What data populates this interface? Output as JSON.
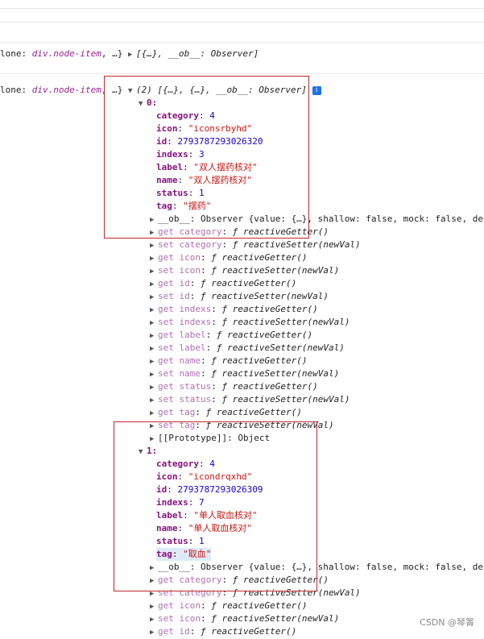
{
  "line1": {
    "prefix": "lone: ",
    "ref": "div.node-item",
    "rest": ", …} ",
    "summary": "[{…}, __ob__: Observer]"
  },
  "line2": {
    "prefix": "lone: ",
    "ref": "div.node-item",
    "rest": ", …} ",
    "summary": "(2) [{…}, {…}, __ob__: Observer]",
    "info": "i"
  },
  "item0": {
    "index": "0:",
    "props": [
      {
        "key": "category",
        "value": "4",
        "type": "num"
      },
      {
        "key": "icon",
        "value": "\"iconsrbyhd\"",
        "type": "str"
      },
      {
        "key": "id",
        "value": "2793787293026320",
        "type": "num"
      },
      {
        "key": "indexs",
        "value": "3",
        "type": "num"
      },
      {
        "key": "label",
        "value": "\"双人摆药核对\"",
        "type": "str"
      },
      {
        "key": "name",
        "value": "\"双人摆药核对\"",
        "type": "str"
      },
      {
        "key": "status",
        "value": "1",
        "type": "num"
      },
      {
        "key": "tag",
        "value": "\"摆药\"",
        "type": "str"
      }
    ],
    "ob_line": "__ob__: Observer {value: {…}, shallow: false, mock: false, dep",
    "accessors": [
      [
        "get",
        "category",
        "reactiveGetter()"
      ],
      [
        "set",
        "category",
        "reactiveSetter(newVal)"
      ],
      [
        "get",
        "icon",
        "reactiveGetter()"
      ],
      [
        "set",
        "icon",
        "reactiveSetter(newVal)"
      ],
      [
        "get",
        "id",
        "reactiveGetter()"
      ],
      [
        "set",
        "id",
        "reactiveSetter(newVal)"
      ],
      [
        "get",
        "indexs",
        "reactiveGetter()"
      ],
      [
        "set",
        "indexs",
        "reactiveSetter(newVal)"
      ],
      [
        "get",
        "label",
        "reactiveGetter()"
      ],
      [
        "set",
        "label",
        "reactiveSetter(newVal)"
      ],
      [
        "get",
        "name",
        "reactiveGetter()"
      ],
      [
        "set",
        "name",
        "reactiveSetter(newVal)"
      ],
      [
        "get",
        "status",
        "reactiveGetter()"
      ],
      [
        "set",
        "status",
        "reactiveSetter(newVal)"
      ],
      [
        "get",
        "tag",
        "reactiveGetter()"
      ],
      [
        "set",
        "tag",
        "reactiveSetter(newVal)"
      ]
    ],
    "prototype": "[[Prototype]]: Object"
  },
  "item1": {
    "index": "1:",
    "props": [
      {
        "key": "category",
        "value": "4",
        "type": "num"
      },
      {
        "key": "icon",
        "value": "\"icondrqxhd\"",
        "type": "str"
      },
      {
        "key": "id",
        "value": "2793787293026309",
        "type": "num"
      },
      {
        "key": "indexs",
        "value": "7",
        "type": "num"
      },
      {
        "key": "label",
        "value": "\"单人取血核对\"",
        "type": "str"
      },
      {
        "key": "name",
        "value": "\"单人取血核对\"",
        "type": "str"
      },
      {
        "key": "status",
        "value": "1",
        "type": "num"
      },
      {
        "key": "tag",
        "value": "\"取血\"",
        "type": "str"
      }
    ],
    "ob_line": "__ob__: Observer {value: {…}, shallow: false, mock: false, dep",
    "accessors": [
      [
        "get",
        "category",
        "reactiveGetter()"
      ],
      [
        "set",
        "category",
        "reactiveSetter(newVal)"
      ],
      [
        "get",
        "icon",
        "reactiveGetter()"
      ],
      [
        "set",
        "icon",
        "reactiveSetter(newVal)"
      ],
      [
        "get",
        "id",
        "reactiveGetter()"
      ]
    ]
  },
  "fn_symbol": "ƒ",
  "watermark": "CSDN @琴箐"
}
